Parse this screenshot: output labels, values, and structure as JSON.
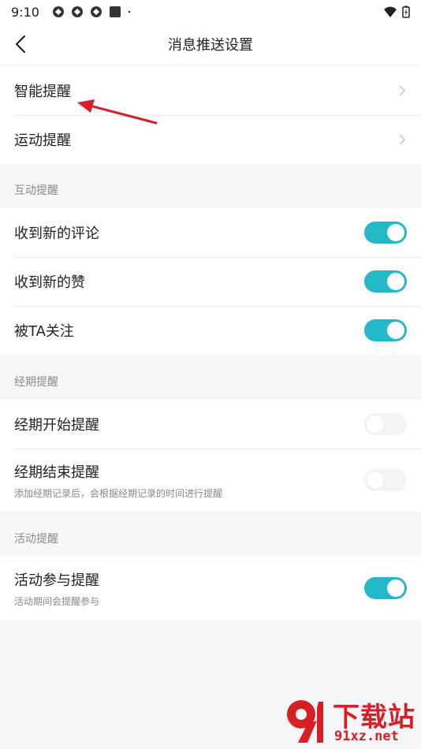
{
  "status_bar": {
    "time": "9:10"
  },
  "header": {
    "title": "消息推送设置"
  },
  "group1": {
    "items": [
      {
        "label": "智能提醒"
      },
      {
        "label": "运动提醒"
      }
    ]
  },
  "interaction": {
    "section_label": "互动提醒",
    "items": [
      {
        "label": "收到新的评论",
        "enabled": true
      },
      {
        "label": "收到新的赞",
        "enabled": true
      },
      {
        "label": "被TA关注",
        "enabled": true
      }
    ]
  },
  "period": {
    "section_label": "经期提醒",
    "items": [
      {
        "label": "经期开始提醒",
        "enabled": false
      },
      {
        "label": "经期结束提醒",
        "sublabel": "添加经期记录后，会根据经期记录的时间进行提醒",
        "enabled": false
      }
    ]
  },
  "activity": {
    "section_label": "活动提醒",
    "items": [
      {
        "label": "活动参与提醒",
        "sublabel": "活动期间会提醒参与",
        "enabled": true
      }
    ]
  },
  "watermark": {
    "top_text": "下载站",
    "bottom_text": "91xz.net"
  },
  "colors": {
    "accent": "#23b9c8",
    "annotation": "#d91f26"
  }
}
